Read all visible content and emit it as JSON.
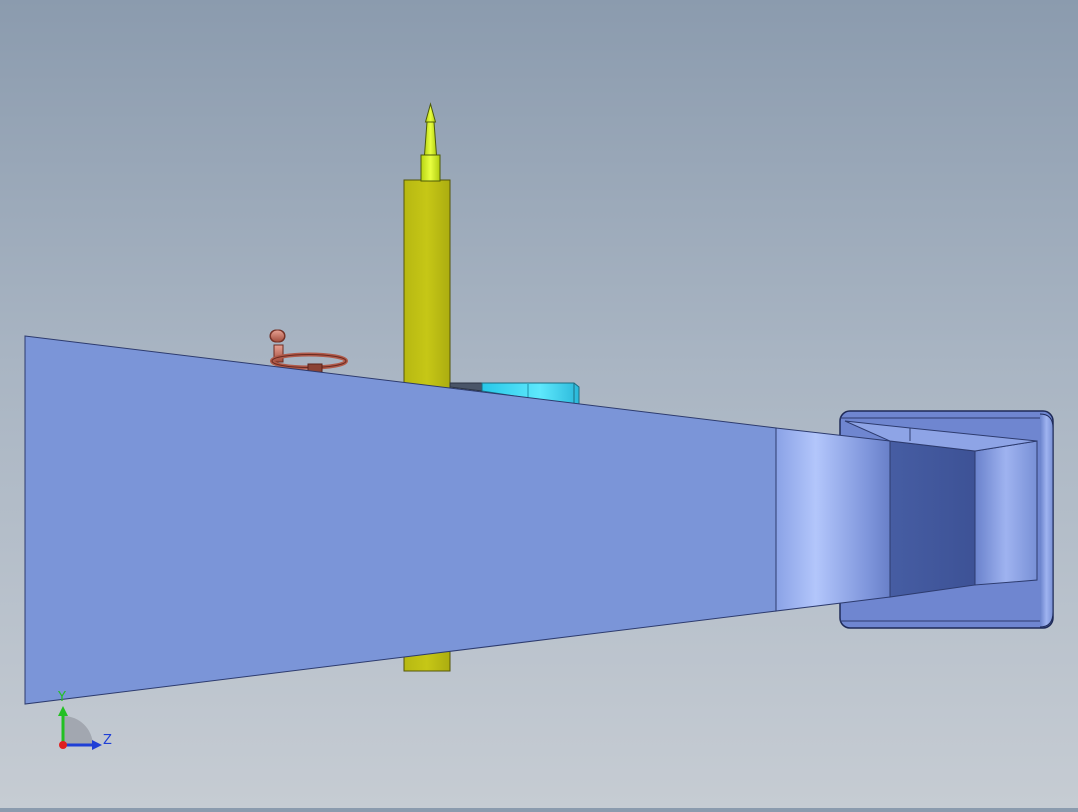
{
  "view": {
    "background_top": "#8b9bae",
    "background_bottom": "#c6ccd3"
  },
  "model": {
    "parts": [
      {
        "name": "tapered-body",
        "color": "#7b95d8"
      },
      {
        "name": "vertical-column",
        "color": "#c3c414"
      },
      {
        "name": "top-pin",
        "color": "#d8f020"
      },
      {
        "name": "handwheel",
        "color": "#c86a5a"
      },
      {
        "name": "cyan-block",
        "color": "#3fdcf2"
      },
      {
        "name": "end-housing",
        "color": "#6f86d0"
      }
    ]
  },
  "triad": {
    "y_label": "Y",
    "z_label": "Z",
    "y_color": "#22c022",
    "z_color": "#1f3fd6",
    "origin_color": "#e02020"
  }
}
